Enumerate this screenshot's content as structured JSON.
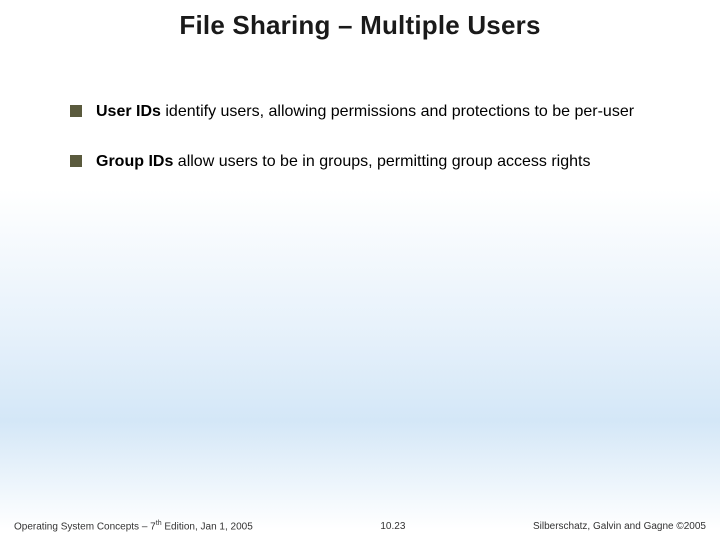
{
  "title": "File Sharing – Multiple Users",
  "bullets": [
    {
      "bold": "User IDs",
      "rest": " identify users, allowing permissions and protections to be per-user"
    },
    {
      "bold": "Group IDs",
      "rest": " allow users to be in groups, permitting group access rights"
    }
  ],
  "footer": {
    "left_a": "Operating System Concepts – 7",
    "left_sup": "th",
    "left_b": " Edition, Jan 1, 2005",
    "center": "10.23",
    "right": "Silberschatz, Galvin and Gagne ©2005"
  }
}
